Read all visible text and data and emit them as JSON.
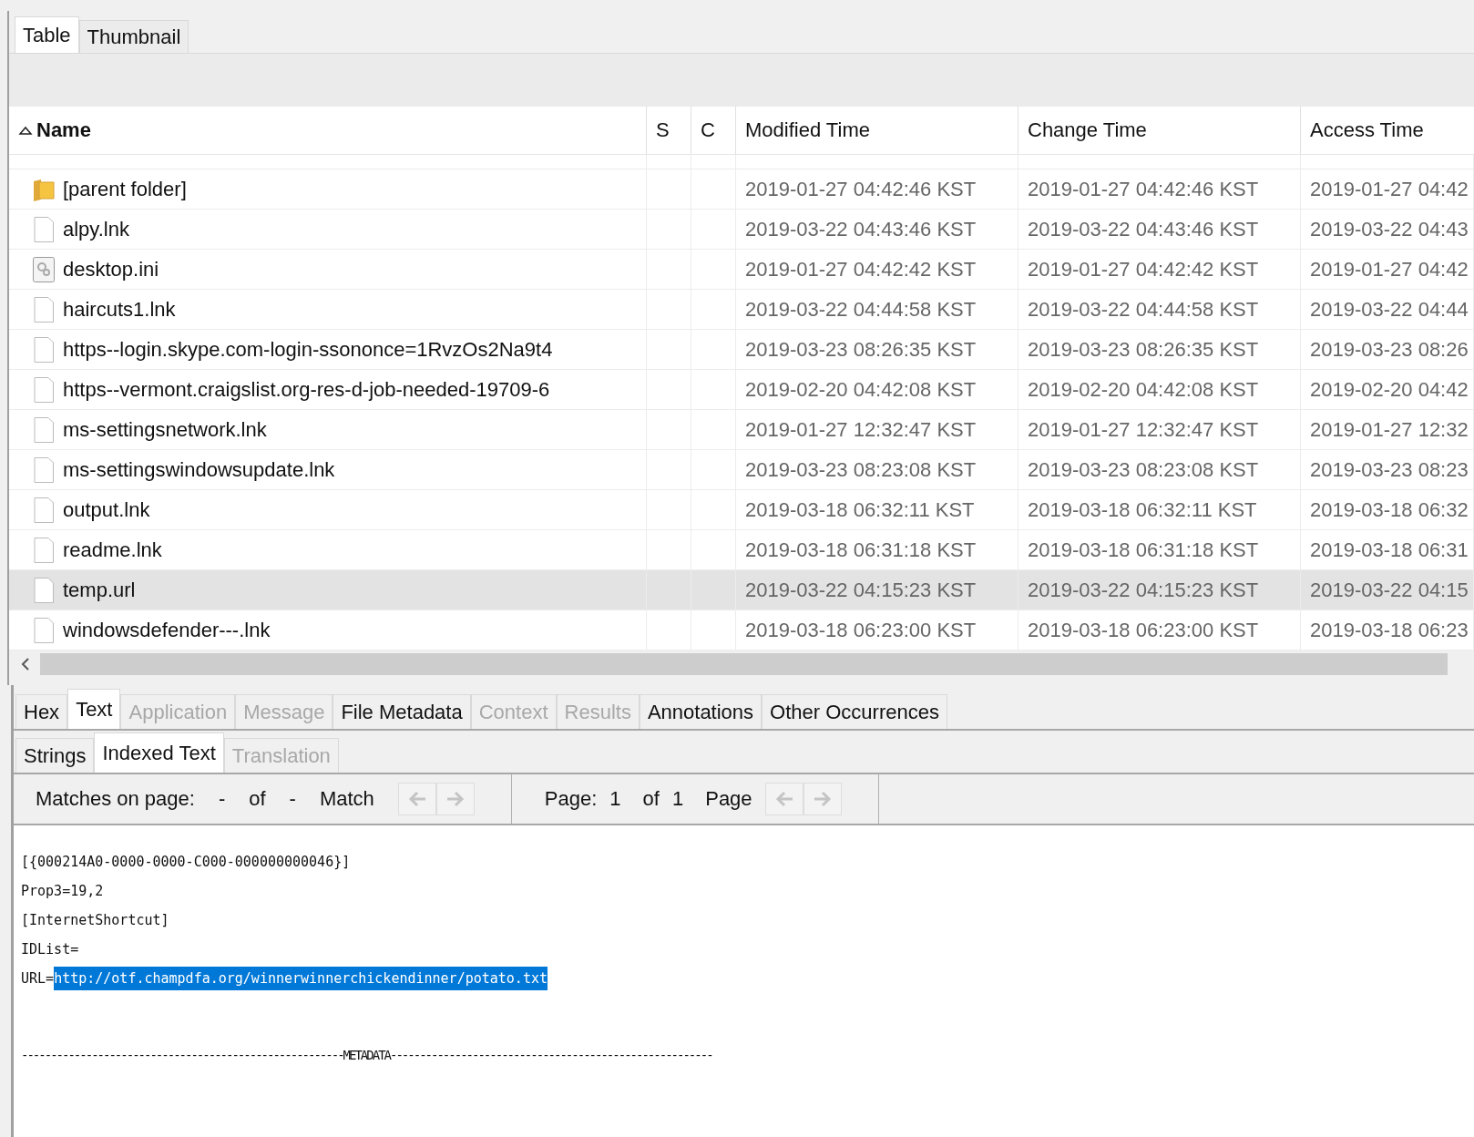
{
  "view_tabs": [
    {
      "label": "Table",
      "selected": true
    },
    {
      "label": "Thumbnail",
      "selected": false
    }
  ],
  "table": {
    "columns": [
      {
        "label": "Name",
        "sorted": true
      },
      {
        "label": "S",
        "sorted": false
      },
      {
        "label": "C",
        "sorted": false
      },
      {
        "label": "Modified Time",
        "sorted": false
      },
      {
        "label": "Change Time",
        "sorted": false
      },
      {
        "label": "Access Time",
        "sorted": false
      }
    ],
    "rows": [
      {
        "kind": "folder",
        "name": "[parent folder]",
        "s": "",
        "c": "",
        "modified": "2019-01-27 04:42:46 KST",
        "changed": "2019-01-27 04:42:46 KST",
        "accessed": "2019-01-27 04:42",
        "selected": false
      },
      {
        "kind": "file",
        "name": "alpy.lnk",
        "s": "",
        "c": "",
        "modified": "2019-03-22 04:43:46 KST",
        "changed": "2019-03-22 04:43:46 KST",
        "accessed": "2019-03-22 04:43",
        "selected": false
      },
      {
        "kind": "settings",
        "name": "desktop.ini",
        "s": "",
        "c": "",
        "modified": "2019-01-27 04:42:42 KST",
        "changed": "2019-01-27 04:42:42 KST",
        "accessed": "2019-01-27 04:42",
        "selected": false
      },
      {
        "kind": "file",
        "name": "haircuts1.lnk",
        "s": "",
        "c": "",
        "modified": "2019-03-22 04:44:58 KST",
        "changed": "2019-03-22 04:44:58 KST",
        "accessed": "2019-03-22 04:44",
        "selected": false
      },
      {
        "kind": "file",
        "name": "https--login.skype.com-login-ssononce=1RvzOs2Na9t4",
        "s": "",
        "c": "",
        "modified": "2019-03-23 08:26:35 KST",
        "changed": "2019-03-23 08:26:35 KST",
        "accessed": "2019-03-23 08:26",
        "selected": false
      },
      {
        "kind": "file",
        "name": "https--vermont.craigslist.org-res-d-job-needed-19709-6",
        "s": "",
        "c": "",
        "modified": "2019-02-20 04:42:08 KST",
        "changed": "2019-02-20 04:42:08 KST",
        "accessed": "2019-02-20 04:42",
        "selected": false
      },
      {
        "kind": "file",
        "name": "ms-settingsnetwork.lnk",
        "s": "",
        "c": "",
        "modified": "2019-01-27 12:32:47 KST",
        "changed": "2019-01-27 12:32:47 KST",
        "accessed": "2019-01-27 12:32",
        "selected": false
      },
      {
        "kind": "file",
        "name": "ms-settingswindowsupdate.lnk",
        "s": "",
        "c": "",
        "modified": "2019-03-23 08:23:08 KST",
        "changed": "2019-03-23 08:23:08 KST",
        "accessed": "2019-03-23 08:23",
        "selected": false
      },
      {
        "kind": "file",
        "name": "output.lnk",
        "s": "",
        "c": "",
        "modified": "2019-03-18 06:32:11 KST",
        "changed": "2019-03-18 06:32:11 KST",
        "accessed": "2019-03-18 06:32",
        "selected": false
      },
      {
        "kind": "file",
        "name": "readme.lnk",
        "s": "",
        "c": "",
        "modified": "2019-03-18 06:31:18 KST",
        "changed": "2019-03-18 06:31:18 KST",
        "accessed": "2019-03-18 06:31",
        "selected": false
      },
      {
        "kind": "file",
        "name": "temp.url",
        "s": "",
        "c": "",
        "modified": "2019-03-22 04:15:23 KST",
        "changed": "2019-03-22 04:15:23 KST",
        "accessed": "2019-03-22 04:15",
        "selected": true
      },
      {
        "kind": "file",
        "name": "windowsdefender---.lnk",
        "s": "",
        "c": "",
        "modified": "2019-03-18 06:23:00 KST",
        "changed": "2019-03-18 06:23:00 KST",
        "accessed": "2019-03-18 06:23",
        "selected": false
      }
    ]
  },
  "viewer_tabs": [
    {
      "label": "Hex",
      "selected": false,
      "disabled": false
    },
    {
      "label": "Text",
      "selected": true,
      "disabled": false
    },
    {
      "label": "Application",
      "selected": false,
      "disabled": true
    },
    {
      "label": "Message",
      "selected": false,
      "disabled": true
    },
    {
      "label": "File Metadata",
      "selected": false,
      "disabled": false
    },
    {
      "label": "Context",
      "selected": false,
      "disabled": true
    },
    {
      "label": "Results",
      "selected": false,
      "disabled": true
    },
    {
      "label": "Annotations",
      "selected": false,
      "disabled": false
    },
    {
      "label": "Other Occurrences",
      "selected": false,
      "disabled": false
    }
  ],
  "text_tabs": [
    {
      "label": "Strings",
      "selected": false,
      "disabled": false
    },
    {
      "label": "Indexed Text",
      "selected": true,
      "disabled": false
    },
    {
      "label": "Translation",
      "selected": false,
      "disabled": true
    }
  ],
  "match_bar": {
    "matches_label": "Matches on page:",
    "match_current": "-",
    "match_of": "of",
    "match_total": "-",
    "match_label": "Match",
    "page_label": "Page:",
    "page_current": "1",
    "page_of": "of",
    "page_total": "1",
    "page_nav_label": "Page"
  },
  "content": {
    "lines": [
      {
        "text": "[{000214A0-0000-0000-C000-000000000046}]"
      },
      {
        "text": "Prop3=19,2"
      },
      {
        "text": "[InternetShortcut]"
      },
      {
        "text": "IDList="
      },
      {
        "text": "URL=",
        "highlight": "http://otf.champdfa.org/winnerwinnerchickendinner/potato.txt"
      }
    ],
    "separator": "-------------------------------------------------------METADATA-------------------------------------------------------"
  }
}
